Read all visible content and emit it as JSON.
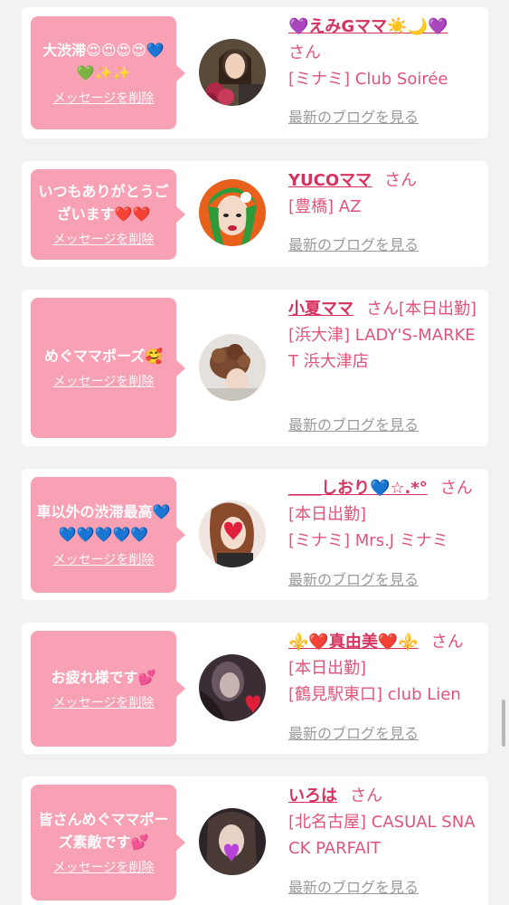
{
  "honorific": "さん",
  "delete_label": "メッセージを削除",
  "blog_label": "最新のブログを見る",
  "cards": [
    {
      "message": "大渋滞😍😍😍😍💙💚✨✨",
      "name": "💜えみGママ☀️🌙💜",
      "status": "",
      "shop": "[ミナミ] Club Soirée"
    },
    {
      "message": "いつもありがとうございます❤️❤️",
      "name": "YUCOママ",
      "status": "",
      "shop": "[豊橋] AZ"
    },
    {
      "message": "めぐママポーズ🥰",
      "name": "小夏ママ",
      "status": "[本日出勤]",
      "shop": "[浜大津] LADY'S-MARKET 浜大津店"
    },
    {
      "message": "車以外の渋滞最高💙💙💙💙💙💙",
      "name": "＿＿しおり💙☆.*°",
      "status": "[本日出勤]",
      "shop": "[ミナミ] Mrs.J ミナミ"
    },
    {
      "message": "お疲れ様です💕",
      "name": "⚜️❤️真由美❤️⚜️",
      "status": "[本日出勤]",
      "shop": "[鶴見駅東口] club Lien"
    },
    {
      "message": "皆さんめぐママポーズ素敵です💕",
      "name": "いろは",
      "status": "",
      "shop": "[北名古屋] CASUAL SNACK PARFAIT"
    }
  ],
  "colors": {
    "bubble": "#f8a0b4",
    "name": "#d7325e",
    "text": "#e0547a",
    "link": "#9a9a9a"
  }
}
